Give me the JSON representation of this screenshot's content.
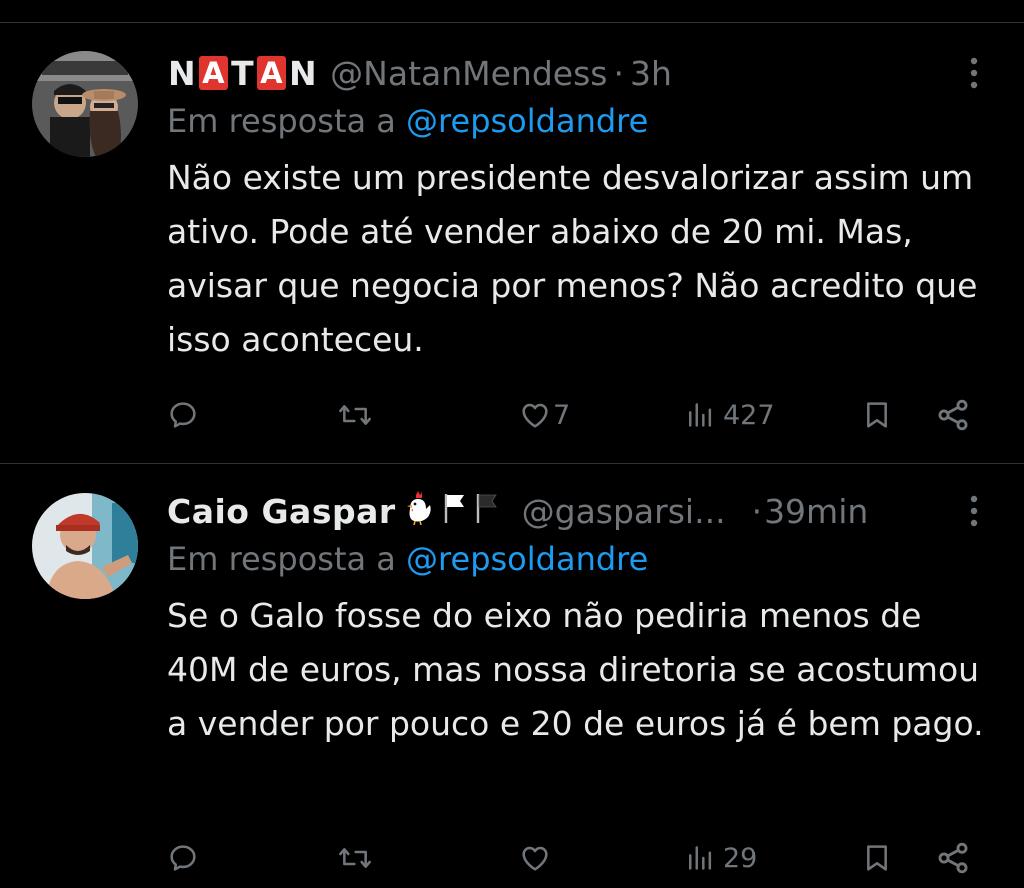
{
  "tweets": [
    {
      "display_name_letters": [
        "N",
        "A",
        "T",
        "A",
        "N"
      ],
      "handle": "@NatanMendess",
      "separator": "·",
      "time": "3h",
      "reply_prefix": "Em resposta a",
      "reply_to": "@repsoldandre",
      "body": "Não existe um presidente desvalorizar assim um ativo. Pode até vender abaixo de 20 mi. Mas, avisar que negocia por menos? Não acredito que isso aconteceu.",
      "likes": "7",
      "views": "427"
    },
    {
      "display_name": "Caio Gaspar",
      "name_icons": [
        "chicken-emoji",
        "white-flag-emoji",
        "black-flag-emoji"
      ],
      "handle": "@gasparsi...",
      "separator": "·",
      "time": "39min",
      "reply_prefix": "Em resposta a",
      "reply_to": "@repsoldandre",
      "body": "Se o Galo fosse do eixo não pediria menos de 40M de euros, mas nossa diretoria se acostumou a vender por pouco e 20 de euros já é bem pago.",
      "likes": "",
      "views": "29"
    }
  ],
  "colors": {
    "background": "#000000",
    "text": "#e7e9ea",
    "muted": "#71767b",
    "link": "#1d9bf0",
    "divider": "#2f3336",
    "natan_badge": "#e0342f"
  }
}
